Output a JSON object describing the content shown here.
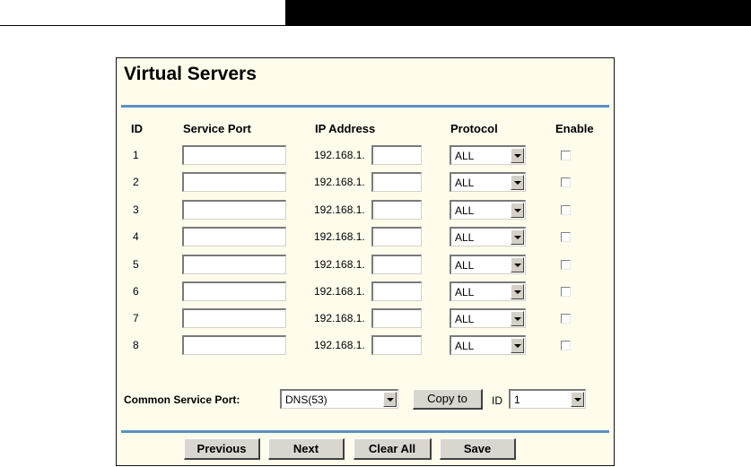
{
  "page": {
    "title": "Virtual Servers",
    "headers": {
      "id": "ID",
      "service_port": "Service Port",
      "ip_address": "IP Address",
      "protocol": "Protocol",
      "enable": "Enable"
    },
    "ip_prefix": "192.168.1.",
    "rows": [
      {
        "id": "1",
        "protocol": "ALL",
        "service_port": "",
        "ip_suffix": "",
        "enabled": false
      },
      {
        "id": "2",
        "protocol": "ALL",
        "service_port": "",
        "ip_suffix": "",
        "enabled": false
      },
      {
        "id": "3",
        "protocol": "ALL",
        "service_port": "",
        "ip_suffix": "",
        "enabled": false
      },
      {
        "id": "4",
        "protocol": "ALL",
        "service_port": "",
        "ip_suffix": "",
        "enabled": false
      },
      {
        "id": "5",
        "protocol": "ALL",
        "service_port": "",
        "ip_suffix": "",
        "enabled": false
      },
      {
        "id": "6",
        "protocol": "ALL",
        "service_port": "",
        "ip_suffix": "",
        "enabled": false
      },
      {
        "id": "7",
        "protocol": "ALL",
        "service_port": "",
        "ip_suffix": "",
        "enabled": false
      },
      {
        "id": "8",
        "protocol": "ALL",
        "service_port": "",
        "ip_suffix": "",
        "enabled": false
      }
    ],
    "common": {
      "label": "Common Service Port:",
      "selected": "DNS(53)",
      "copy_button": "Copy to",
      "id_label": "ID",
      "id_selected": "1"
    },
    "buttons": {
      "previous": "Previous",
      "next": "Next",
      "clear_all": "Clear All",
      "save": "Save"
    }
  },
  "colors": {
    "panel_background": "#fffcec",
    "accent_rule": "#5b8fc1",
    "button_face": "#d9d6cf"
  }
}
